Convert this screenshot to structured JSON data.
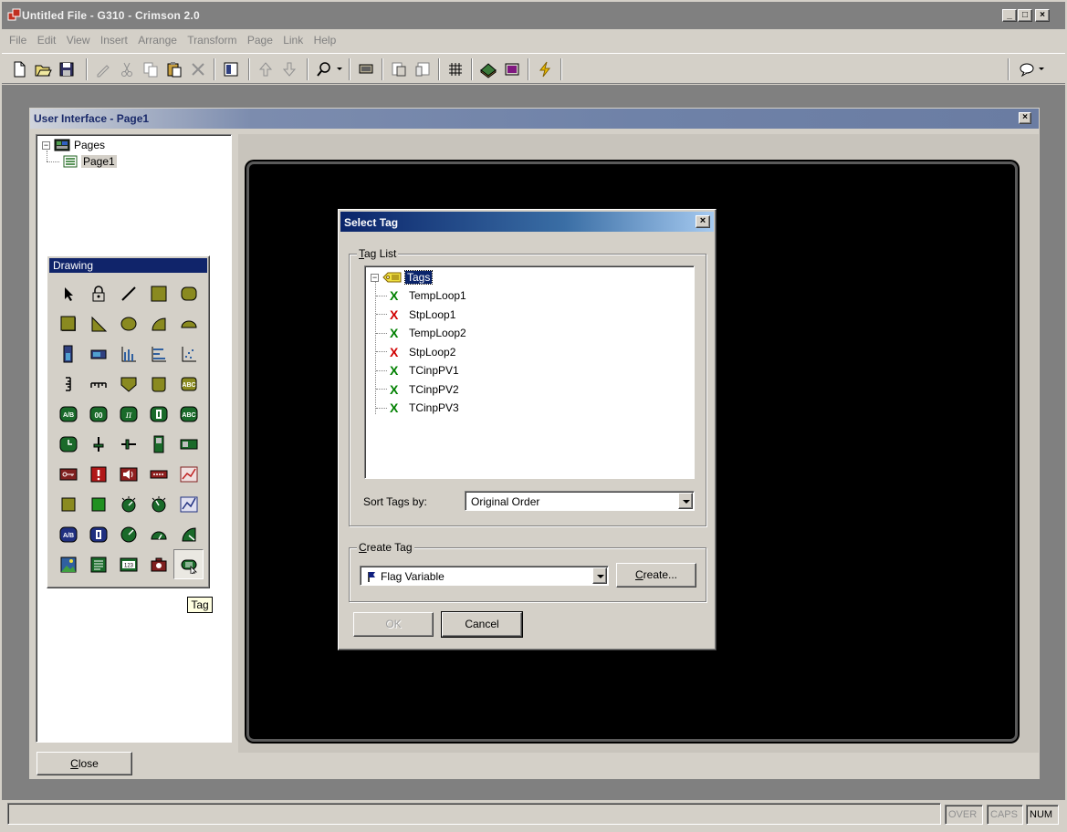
{
  "window": {
    "title": "Untitled File - G310 - Crimson 2.0"
  },
  "menu": [
    "File",
    "Edit",
    "View",
    "Insert",
    "Arrange",
    "Transform",
    "Page",
    "Link",
    "Help"
  ],
  "toolbar": {
    "icons": [
      "new-icon",
      "open-icon",
      "save-icon",
      "pencil-icon",
      "cut-icon",
      "copy-icon",
      "paste-icon",
      "delete-icon",
      "properties-icon",
      "move-up-icon",
      "move-down-icon",
      "zoom-icon",
      "monitor-icon",
      "page-props-icon",
      "page-props2-icon",
      "grid-icon",
      "book-icon",
      "display-icon",
      "lightning-icon",
      "comment-icon"
    ]
  },
  "child_window": {
    "title": "User Interface - Page1",
    "tree": {
      "root": "Pages",
      "child": "Page1"
    },
    "close_button": "Close"
  },
  "palette": {
    "title": "Drawing",
    "tooltip": "Tag"
  },
  "dialog": {
    "title": "Select Tag",
    "tag_list_label": "Tag List",
    "tag_list_label_accel": "T",
    "tag_list_label_rest": "ag List",
    "root_label": "Tags",
    "tags": [
      {
        "name": "TempLoop1",
        "color": "#008000"
      },
      {
        "name": "StpLoop1",
        "color": "#d00000"
      },
      {
        "name": "TempLoop2",
        "color": "#008000"
      },
      {
        "name": "StpLoop2",
        "color": "#d00000"
      },
      {
        "name": "TCinpPV1",
        "color": "#008000"
      },
      {
        "name": "TCinpPV2",
        "color": "#008000"
      },
      {
        "name": "TCinpPV3",
        "color": "#008000"
      }
    ],
    "sort_label": "Sort Tags by:",
    "sort_value": "Original Order",
    "create_group_accel": "C",
    "create_group_rest": "reate Tag",
    "create_type": "Flag Variable",
    "create_button_accel": "C",
    "create_button_rest": "reate...",
    "ok_button": "OK",
    "cancel_button": "Cancel"
  },
  "status": {
    "indicators": [
      {
        "label": "OVER",
        "active": false
      },
      {
        "label": "CAPS",
        "active": false
      },
      {
        "label": "NUM",
        "active": true
      }
    ]
  }
}
